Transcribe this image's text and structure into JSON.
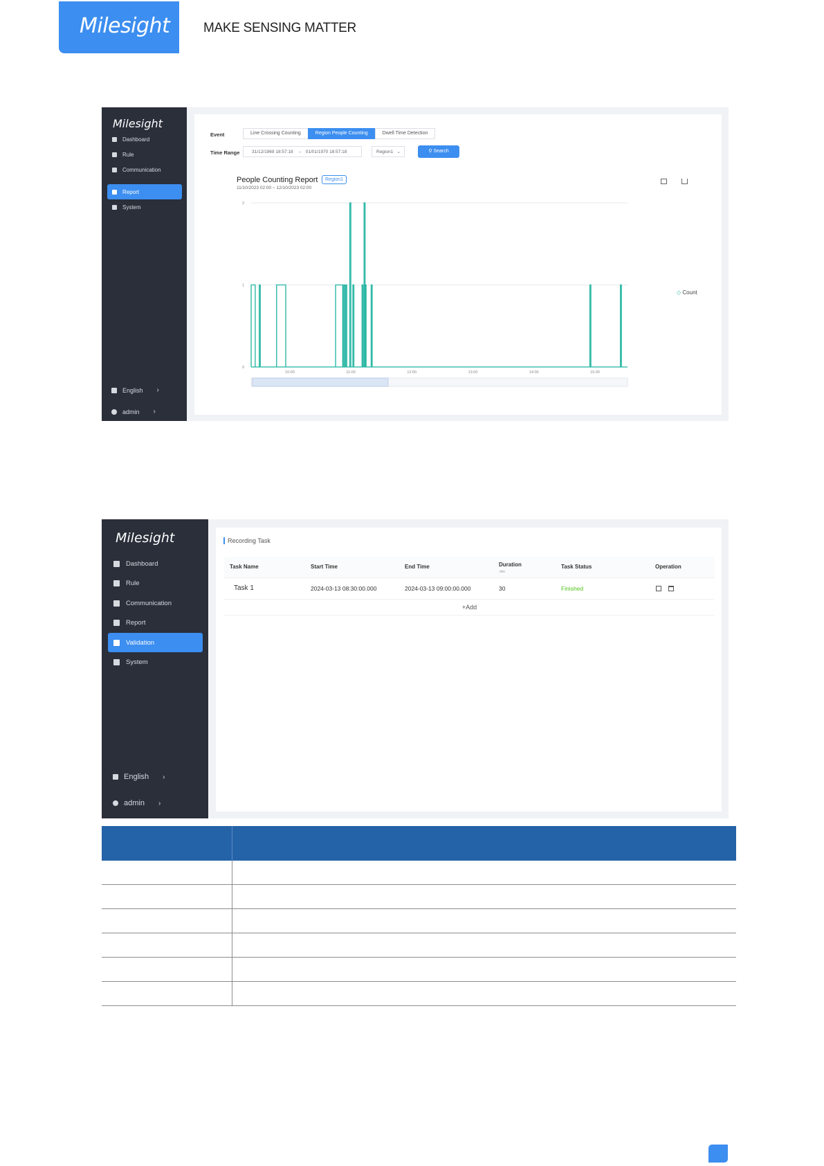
{
  "header": {
    "brand": "Milesight",
    "tagline": "MAKE SENSING MATTER"
  },
  "app1": {
    "logo": "Milesight",
    "nav": [
      {
        "label": "Dashboard",
        "icon": "dashboard-icon",
        "active": false
      },
      {
        "label": "Rule",
        "icon": "rule-icon",
        "active": false
      },
      {
        "label": "Communication",
        "icon": "communication-icon",
        "active": false
      },
      {
        "label": "Report",
        "icon": "report-icon",
        "active": true
      },
      {
        "label": "System",
        "icon": "gear-icon",
        "active": false
      }
    ],
    "language": "English",
    "user": "admin",
    "event_label": "Event",
    "tabs": [
      "Line Crossing Counting",
      "Region People Counting",
      "Dwell Time Detection"
    ],
    "active_tab": 1,
    "time_range_label": "Time Range",
    "date_start": "31/12/1969 18:57:18",
    "date_sep": "→",
    "date_end": "01/01/1970 18:57:18",
    "region_select": "Region1",
    "search_label": "Search",
    "report_title": "People Counting Report",
    "region_tag": "Region1",
    "report_range": "11/10/2023 02:00 ~ 12/10/2023 02:00",
    "series_color": "#1fb3a0"
  },
  "chart_data": {
    "type": "line",
    "title": "People Counting Report",
    "x_tick_labels": [
      "10:00",
      "11:00",
      "12:00",
      "13:00",
      "14:00",
      "15:00"
    ],
    "y_ticks": [
      0,
      1,
      2
    ],
    "ylim": [
      0,
      2
    ],
    "xlim": [
      "09:22",
      "15:32"
    ],
    "legend": "Count",
    "legend_position": "right",
    "series": [
      {
        "name": "Count",
        "step_intervals": [
          {
            "start": "09:22",
            "end": "09:26",
            "value": 1
          },
          {
            "start": "09:30",
            "end": "09:31",
            "value": 1
          },
          {
            "start": "09:47",
            "end": "09:56",
            "value": 1
          },
          {
            "start": "10:45",
            "end": "10:52",
            "value": 1
          },
          {
            "start": "10:53",
            "end": "10:54",
            "value": 1
          },
          {
            "start": "10:55",
            "end": "10:56",
            "value": 1
          },
          {
            "start": "10:59",
            "end": "11:00",
            "value": 2
          },
          {
            "start": "11:02",
            "end": "11:03",
            "value": 1
          },
          {
            "start": "11:11",
            "end": "11:12",
            "value": 1
          },
          {
            "start": "11:13",
            "end": "11:14",
            "value": 2
          },
          {
            "start": "11:14",
            "end": "11:15",
            "value": 1
          },
          {
            "start": "11:20",
            "end": "11:21",
            "value": 1
          },
          {
            "start": "14:55",
            "end": "14:56",
            "value": 1
          },
          {
            "start": "15:25",
            "end": "15:26",
            "value": 1
          }
        ]
      }
    ]
  },
  "app2": {
    "logo": "Milesight",
    "nav": [
      {
        "label": "Dashboard",
        "icon": "dashboard-icon",
        "active": false
      },
      {
        "label": "Rule",
        "icon": "rule-icon",
        "active": false
      },
      {
        "label": "Communication",
        "icon": "communication-icon",
        "active": false
      },
      {
        "label": "Report",
        "icon": "report-icon",
        "active": false
      },
      {
        "label": "Validation",
        "icon": "validation-icon",
        "active": true
      },
      {
        "label": "System",
        "icon": "gear-icon",
        "active": false
      }
    ],
    "language": "English",
    "user": "admin",
    "section_title": "Recording Task",
    "columns": [
      "Task Name",
      "Start Time",
      "End Time",
      "Duration",
      "Task Status",
      "Operation"
    ],
    "duration_unit": "min",
    "rows": [
      {
        "name": "Task 1",
        "start": "2024-03-13 08:30:00.000",
        "end": "2024-03-13 09:00:00.000",
        "duration": "30",
        "status": "Finished"
      }
    ],
    "add_label": "+Add"
  }
}
